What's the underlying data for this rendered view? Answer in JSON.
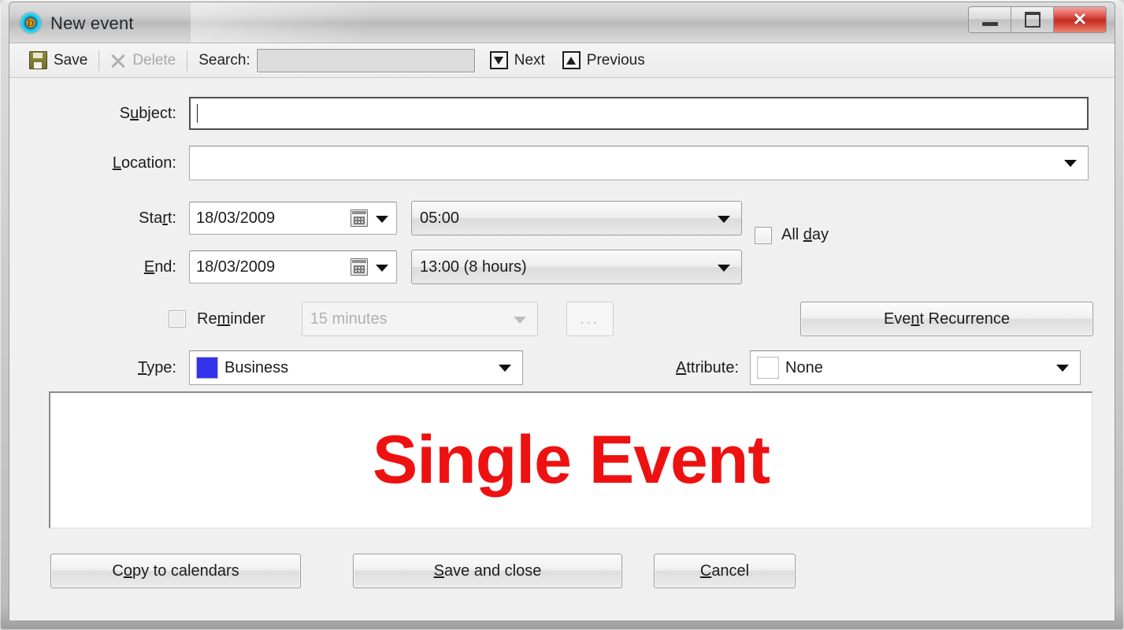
{
  "window": {
    "title": "New event",
    "app_icon": "calendar-app-icon",
    "controls": {
      "minimize": "minimize-button",
      "maximize": "maximize-button",
      "close": "close-button",
      "close_glyph": "✕"
    }
  },
  "toolbar": {
    "save_label": "Save",
    "delete_label": "Delete",
    "search_label": "Search:",
    "search_value": "",
    "search_placeholder": "",
    "next_label": "Next",
    "previous_label": "Previous"
  },
  "form": {
    "subject": {
      "label": "S",
      "label_key": "u",
      "label_rest": "bject:",
      "value": ""
    },
    "location": {
      "label": "",
      "label_key": "L",
      "label_rest": "ocation:",
      "value": ""
    },
    "start": {
      "label": "Sta",
      "label_key": "r",
      "label_rest": "t:",
      "date": "18/03/2009",
      "time": "05:00"
    },
    "end": {
      "label": "",
      "label_key": "E",
      "label_rest": "nd:",
      "date": "18/03/2009",
      "time": "13:00 (8 hours)"
    },
    "all_day": {
      "label": "All ",
      "label_key": "d",
      "label_rest": "ay",
      "checked": false
    },
    "reminder": {
      "label": "Re",
      "label_key": "m",
      "label_rest": "inder",
      "checked": false,
      "interval": "15 minutes",
      "more_label": "..."
    },
    "event_recurrence": {
      "label": "Eve",
      "label_key": "n",
      "label_rest": "t Recurrence"
    },
    "type": {
      "label": "",
      "label_key": "T",
      "label_rest": "ype:",
      "value": "Business",
      "swatch_color": "#3333ee"
    },
    "attribute": {
      "label": "",
      "label_key": "A",
      "label_rest": "ttribute:",
      "value": "None",
      "swatch_color": "#ffffff"
    },
    "notes": {
      "text": "Single Event",
      "text_color": "#ee1111"
    }
  },
  "footer": {
    "copy": {
      "label": "C",
      "label_key": "o",
      "label_rest": "py to calendars"
    },
    "save_close": {
      "label": "",
      "label_key": "S",
      "label_rest": "ave and close"
    },
    "cancel": {
      "label": "",
      "label_key": "C",
      "label_rest": "ancel"
    }
  }
}
